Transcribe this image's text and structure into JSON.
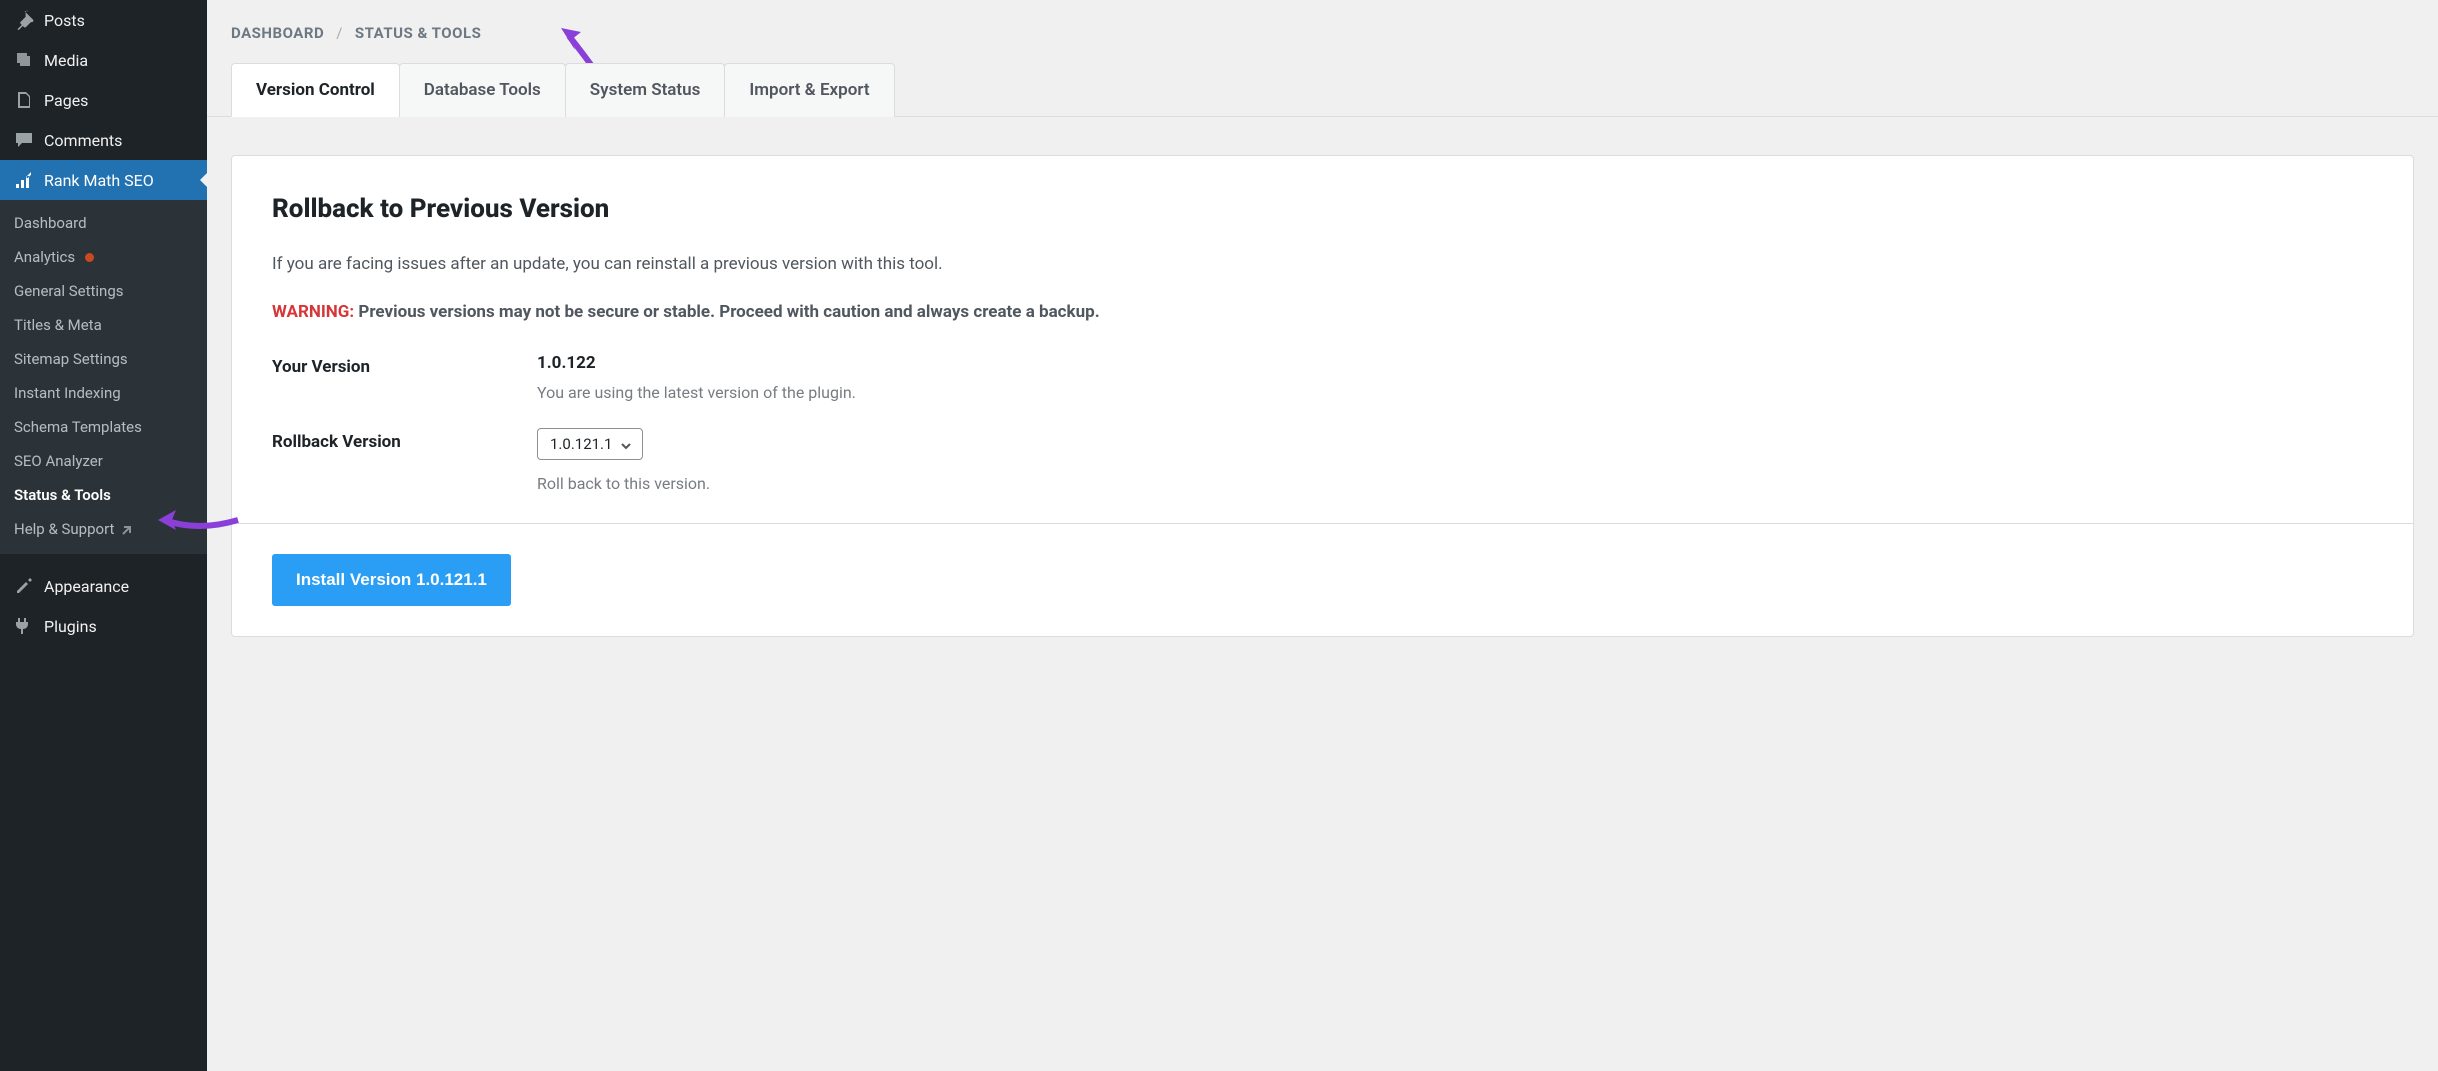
{
  "sidebar": {
    "posts": "Posts",
    "media": "Media",
    "pages": "Pages",
    "comments": "Comments",
    "rankmath": "Rank Math SEO",
    "submenu": {
      "dashboard": "Dashboard",
      "analytics": "Analytics",
      "general": "General Settings",
      "titles": "Titles & Meta",
      "sitemap": "Sitemap Settings",
      "indexing": "Instant Indexing",
      "schema": "Schema Templates",
      "analyzer": "SEO Analyzer",
      "status": "Status & Tools",
      "help": "Help & Support"
    },
    "appearance": "Appearance",
    "plugins": "Plugins"
  },
  "breadcrumb": {
    "root": "DASHBOARD",
    "current": "STATUS & TOOLS"
  },
  "tabs": {
    "version_control": "Version Control",
    "database_tools": "Database Tools",
    "system_status": "System Status",
    "import_export": "Import & Export"
  },
  "rollback": {
    "heading": "Rollback to Previous Version",
    "intro": "If you are facing issues after an update, you can reinstall a previous version with this tool.",
    "warning_label": "WARNING:",
    "warning_text": "Previous versions may not be secure or stable. Proceed with caution and always create a backup.",
    "your_version_label": "Your Version",
    "your_version_value": "1.0.122",
    "your_version_desc": "You are using the latest version of the plugin.",
    "rollback_version_label": "Rollback Version",
    "rollback_version_value": "1.0.121.1",
    "rollback_version_desc": "Roll back to this version.",
    "install_button": "Install Version 1.0.121.1"
  }
}
